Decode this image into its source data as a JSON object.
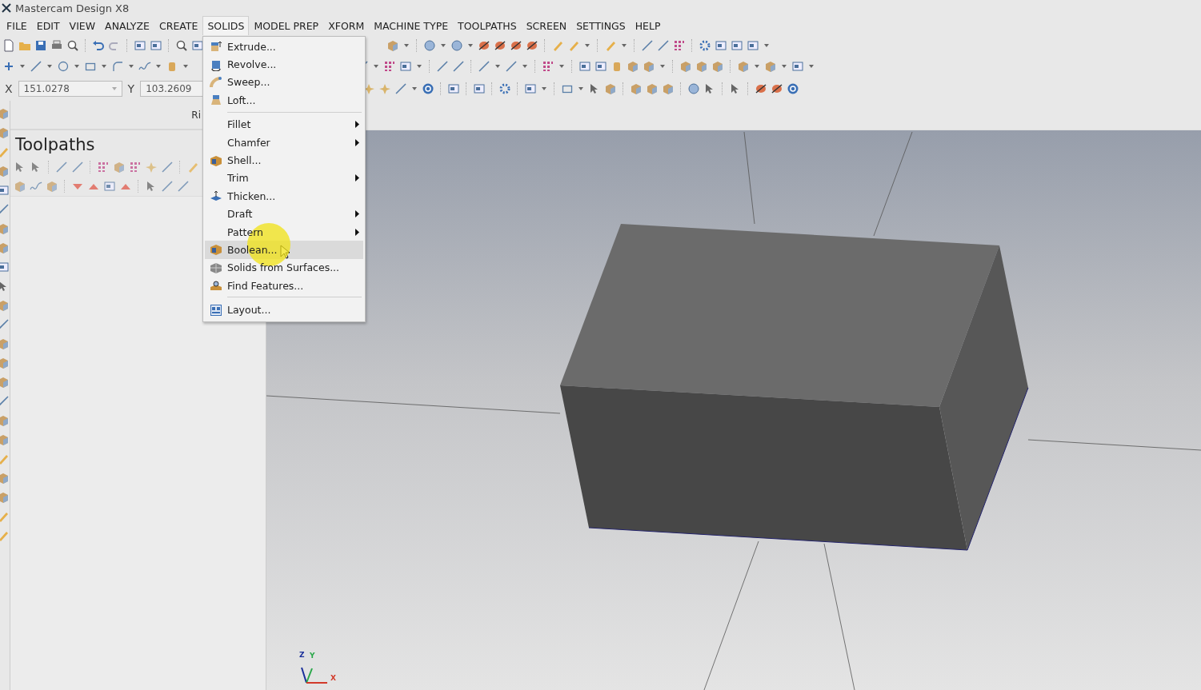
{
  "window": {
    "title": "Mastercam Design X8"
  },
  "menubar": [
    {
      "label": "FILE",
      "selected": false
    },
    {
      "label": "EDIT",
      "selected": false
    },
    {
      "label": "VIEW",
      "selected": false
    },
    {
      "label": "ANALYZE",
      "selected": false
    },
    {
      "label": "CREATE",
      "selected": false
    },
    {
      "label": "SOLIDS",
      "selected": true
    },
    {
      "label": "MODEL PREP",
      "selected": false
    },
    {
      "label": "XFORM",
      "selected": false
    },
    {
      "label": "MACHINE TYPE",
      "selected": false
    },
    {
      "label": "TOOLPATHS",
      "selected": false
    },
    {
      "label": "SCREEN",
      "selected": false
    },
    {
      "label": "SETTINGS",
      "selected": false
    },
    {
      "label": "HELP",
      "selected": false
    }
  ],
  "coordinates": {
    "x_label": "X",
    "x_value": "151.0278",
    "y_label": "Y",
    "y_value": "103.2609"
  },
  "cut_label": "Ri",
  "panel": {
    "title": "Toolpaths"
  },
  "solids_menu": [
    {
      "label": "Extrude...",
      "kind": "command",
      "separator_before": false,
      "selected": false
    },
    {
      "label": "Revolve...",
      "kind": "command",
      "separator_before": false,
      "selected": false
    },
    {
      "label": "Sweep...",
      "kind": "command",
      "separator_before": false,
      "selected": false
    },
    {
      "label": "Loft...",
      "kind": "command",
      "separator_before": false,
      "selected": false
    },
    {
      "label": "Fillet",
      "kind": "submenu",
      "separator_before": true,
      "selected": false
    },
    {
      "label": "Chamfer",
      "kind": "submenu",
      "separator_before": false,
      "selected": false
    },
    {
      "label": "Shell...",
      "kind": "command",
      "separator_before": false,
      "selected": false
    },
    {
      "label": "Trim",
      "kind": "submenu",
      "separator_before": false,
      "selected": false
    },
    {
      "label": "Thicken...",
      "kind": "command",
      "separator_before": false,
      "selected": false
    },
    {
      "label": "Draft",
      "kind": "submenu",
      "separator_before": false,
      "selected": false
    },
    {
      "label": "Pattern",
      "kind": "submenu",
      "separator_before": false,
      "selected": false
    },
    {
      "label": "Boolean...",
      "kind": "command",
      "separator_before": false,
      "selected": true
    },
    {
      "label": "Solids from Surfaces...",
      "kind": "command",
      "separator_before": false,
      "selected": false
    },
    {
      "label": "Find Features...",
      "kind": "command",
      "separator_before": false,
      "selected": false
    },
    {
      "label": "Layout...",
      "kind": "command",
      "separator_before": true,
      "selected": false
    }
  ],
  "triad": {
    "z": "Z",
    "y": "Y",
    "x": "X"
  }
}
